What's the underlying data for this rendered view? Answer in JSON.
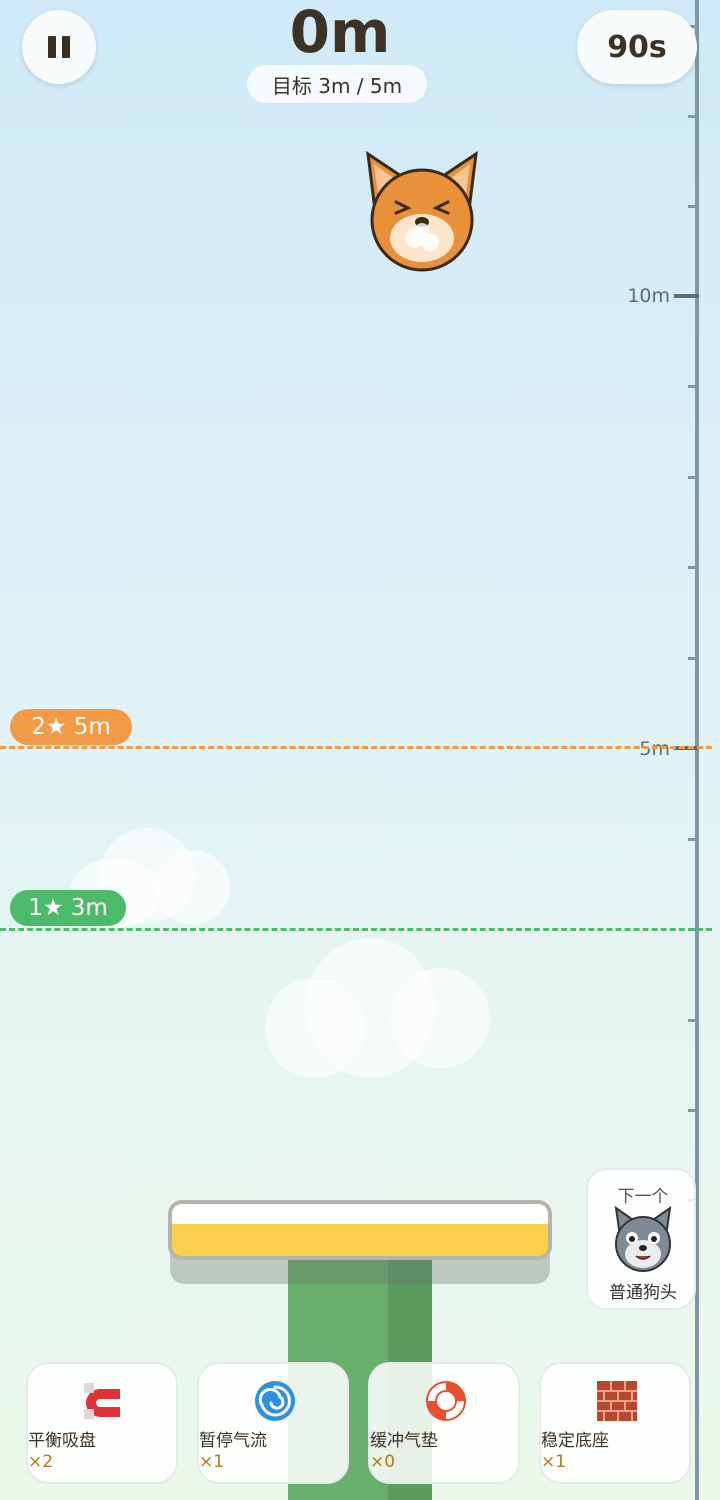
{
  "hud": {
    "height": "0m",
    "target": "目标 3m / 5m",
    "timer": "90s"
  },
  "ruler": {
    "label_10": "10m",
    "label_5": "5m"
  },
  "goals": {
    "two_star": "2★ 5m",
    "one_star": "1★ 3m",
    "two_star_color": "#f29a45",
    "one_star_color": "#4cba6a"
  },
  "next_piece": {
    "title": "下一个",
    "name": "普通狗头",
    "icon": "wolf-icon"
  },
  "powerups": [
    {
      "name": "平衡吸盘",
      "count": "×2",
      "icon": "magnet-icon"
    },
    {
      "name": "暂停气流",
      "count": "×1",
      "icon": "cyclone-icon"
    },
    {
      "name": "缓冲气垫",
      "count": "×0",
      "icon": "lifebuoy-icon"
    },
    {
      "name": "稳定底座",
      "count": "×1",
      "icon": "brick-icon"
    }
  ]
}
